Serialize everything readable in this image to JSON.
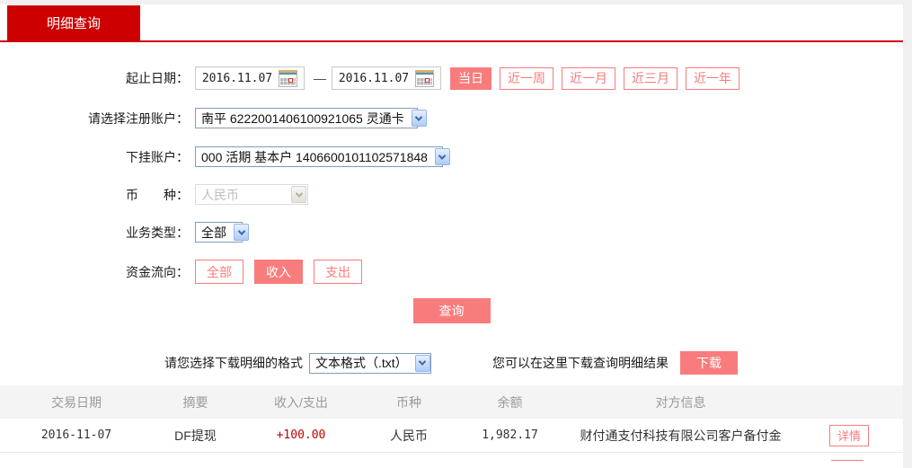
{
  "tab": {
    "label": "明细查询"
  },
  "form": {
    "date_row": {
      "label": "起止日期：",
      "start_date": "2016.11.07",
      "end_date": "2016.11.07",
      "separator": "—",
      "quick_buttons": [
        {
          "label": "当日",
          "active": true
        },
        {
          "label": "近一周",
          "active": false
        },
        {
          "label": "近一月",
          "active": false
        },
        {
          "label": "近三月",
          "active": false
        },
        {
          "label": "近一年",
          "active": false
        }
      ]
    },
    "register_account": {
      "label": "请选择注册账户：",
      "value": "南平 6222001406100921065 灵通卡"
    },
    "sub_account": {
      "label": "下挂账户：",
      "value": "000 活期 基本户 1406600101102571848"
    },
    "currency": {
      "label": "币　　种：",
      "value": "人民币",
      "disabled": true
    },
    "business_type": {
      "label": "业务类型：",
      "value": "全部"
    },
    "fund_direction": {
      "label": "资金流向：",
      "options": [
        {
          "label": "全部",
          "active": false
        },
        {
          "label": "收入",
          "active": true
        },
        {
          "label": "支出",
          "active": false
        }
      ]
    },
    "query_button": "查询"
  },
  "download": {
    "format_label": "请您选择下载明细的格式",
    "format_value": "文本格式（.txt）",
    "hint": "您可以在这里下载查询明细结果",
    "button": "下载"
  },
  "table": {
    "headers": [
      "交易日期",
      "摘要",
      "收入/支出",
      "币种",
      "余额",
      "对方信息"
    ],
    "rows": [
      {
        "date": "2016-11-07",
        "summary": "DF提现",
        "amount": "+100.00",
        "currency": "人民币",
        "balance": "1,982.17",
        "counterparty": "财付通支付科技有限公司客户备付金",
        "action": "详情"
      }
    ]
  },
  "colors": {
    "brand_red": "#cc0001",
    "accent_salmon": "#f97c7c",
    "amount_positive": "#c00000",
    "header_text": "#9a9a9a"
  }
}
